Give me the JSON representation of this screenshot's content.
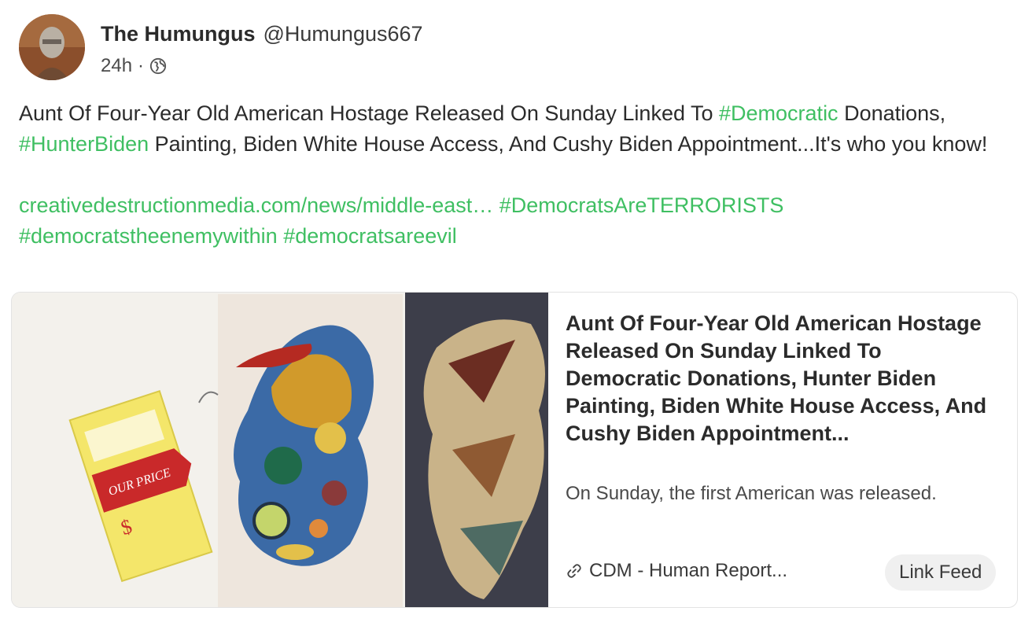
{
  "post": {
    "author": {
      "display_name": "The Humungus",
      "handle": "@Humungus667",
      "time": "24h",
      "separator": "·",
      "visibility_icon": "globe-icon"
    },
    "body": {
      "p1_text1": "Aunt Of Four-Year Old American Hostage Released On Sunday Linked To ",
      "p1_tag1": "#Democratic",
      "p1_text2": " Donations, ",
      "p1_tag2": "#HunterBiden",
      "p1_text3": " Painting, Biden White House Access, And Cushy Biden Appointment...It's who you know!",
      "p2_link": "creativedestructionmedia.com/news/middle-east…",
      "p2_tag1": "#DemocratsAreTERRORISTS",
      "p2_tag2": "#democratstheenemywithin",
      "p2_tag3": "#democratsareevil"
    },
    "link_card": {
      "title": "Aunt Of Four-Year Old American Hostage Released On Sunday Linked To Democratic Donations, Hunter Biden Painting, Biden White House Access, And Cushy Biden Appointment...",
      "description": "On Sunday, the first American was released.",
      "source": "CDM - Human Report...",
      "source_icon": "link-icon",
      "button_label": "Link Feed",
      "image_tag_text": "OUR PRICE",
      "image_tag_symbol": "$"
    }
  },
  "colors": {
    "hashtag": "#3fbf62",
    "text": "#2b2b2b",
    "card_border": "#e3e3e3",
    "button_bg": "#f0f0f0"
  }
}
